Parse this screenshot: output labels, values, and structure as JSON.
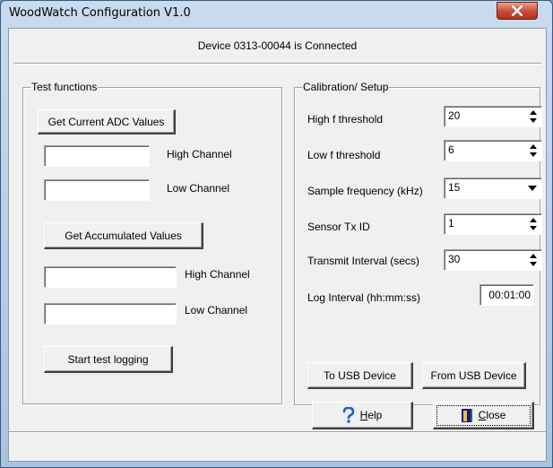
{
  "window": {
    "title": "WoodWatch Configuration V1.0",
    "close_glyph": "X"
  },
  "status": "Device 0313-00044 is Connected",
  "test": {
    "legend": "Test functions",
    "adc_button": "Get Current ADC Values",
    "adc_high_label": "High Channel",
    "adc_high_value": "",
    "adc_low_label": "Low Channel",
    "adc_low_value": "",
    "acc_button": "Get Accumulated Values",
    "acc_high_label": "High Channel",
    "acc_high_value": "",
    "acc_low_label": "Low Channel",
    "acc_low_value": "",
    "log_button": "Start test logging"
  },
  "calib": {
    "legend": "Calibration/ Setup",
    "high_label": "High f threshold",
    "high_value": "20",
    "low_label": "Low f threshold",
    "low_value": "6",
    "freq_label": "Sample frequency (kHz)",
    "freq_value": "15",
    "tx_label": "Sensor Tx ID",
    "tx_value": "1",
    "interval_label": "Transmit Interval (secs)",
    "interval_value": "30",
    "log_label": "Log Interval  (hh:mm:ss)",
    "log_value": "00:01:00",
    "to_usb": "To USB Device",
    "from_usb": "From USB Device"
  },
  "footer": {
    "help_rest": "elp",
    "help_key": "H",
    "close_key": "C",
    "close_rest": "lose"
  },
  "colors": {
    "help_icon": "#1f5bd0",
    "close_icon": "#1a1a8c",
    "title_close_bg": "#c74b33"
  }
}
